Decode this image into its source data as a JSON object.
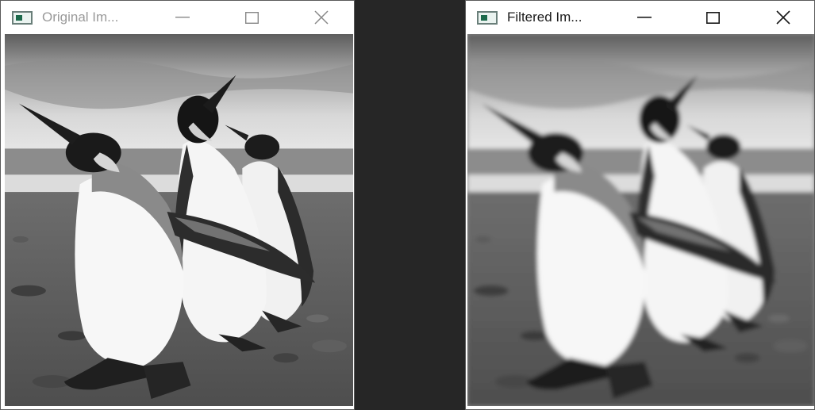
{
  "left_window": {
    "title": "Original Im...",
    "icon": "app-image-icon",
    "controls": [
      "minimize-icon",
      "maximize-icon",
      "close-icon"
    ],
    "image_description": "Three king penguins standing on a beach, sharp grayscale"
  },
  "right_window": {
    "title": "Filtered Im...",
    "icon": "app-image-icon",
    "controls": [
      "minimize-icon",
      "maximize-icon",
      "close-icon"
    ],
    "image_description": "Same three king penguins, blurred (filtered) grayscale"
  },
  "colors": {
    "desktop": "#262626",
    "titlebar": "#ffffff",
    "inactive_title": "#9a9a9a",
    "active_title": "#1a1a1a"
  }
}
